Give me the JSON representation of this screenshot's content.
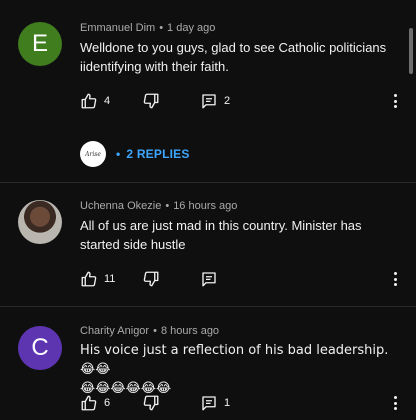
{
  "comments": [
    {
      "avatar_letter": "E",
      "avatar_color": "#3f7d1f",
      "author": "Emmanuel Dim",
      "time": "1 day ago",
      "text_line1": "Welldone to you guys, glad to see Catholic politicians",
      "text_line2": "iidentifying with their faith.",
      "likes": "4",
      "replies_count": "2",
      "view_replies": "2 REPLIES"
    },
    {
      "author": "Uchenna Okezie",
      "time": "16 hours ago",
      "text_line1": "All of us are just mad in this country. Minister has",
      "text_line2": "started side hustle",
      "likes": "11"
    },
    {
      "avatar_letter": "C",
      "avatar_color": "#5e35b1",
      "author": "Charity Anigor",
      "time": "8 hours ago",
      "text_line1": "His voice just a reflection of his bad leadership. 😂😂",
      "text_line2": "😂😂😂😂😂😂",
      "likes": "6",
      "replies_count": "1"
    }
  ],
  "creator_badge_text": "Arise",
  "separator": "•",
  "colors": {
    "background": "#0f0f0f",
    "link": "#3ea6ff",
    "meta": "#aaaaaa"
  }
}
